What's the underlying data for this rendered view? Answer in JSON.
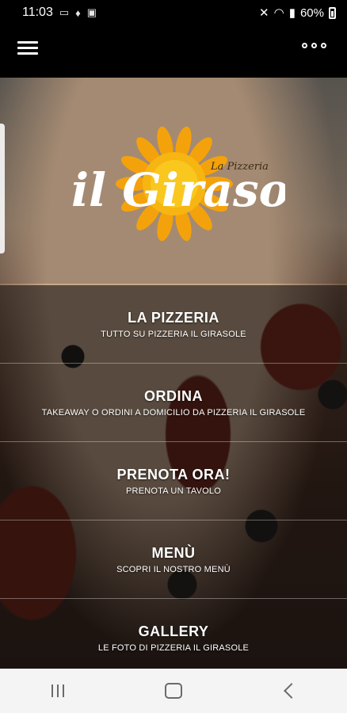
{
  "status_bar": {
    "time": "11:03",
    "battery": "60%",
    "icons": [
      "laptop-icon",
      "notification-icon",
      "message-icon",
      "mute-icon",
      "wifi-icon",
      "signal-icon",
      "battery-icon"
    ]
  },
  "app_bar": {
    "menu_icon": "hamburger-menu-icon",
    "more_icon": "more-options-icon"
  },
  "logo": {
    "name": "il Girasole",
    "script_text": "La Pizzeria",
    "colors": {
      "sun": "#f4a20c",
      "sun_center": "#f7c21a",
      "text": "#ffffff"
    }
  },
  "menu": [
    {
      "title": "LA PIZZERIA",
      "subtitle": "TUTTO SU PIZZERIA IL GIRASOLE"
    },
    {
      "title": "ORDINA",
      "subtitle": "TAKEAWAY O ORDINI A DOMICILIO DA PIZZERIA IL GIRASOLE"
    },
    {
      "title": "PRENOTA ORA!",
      "subtitle": "PRENOTA UN TAVOLO"
    },
    {
      "title": "MENÙ",
      "subtitle": "SCOPRI IL NOSTRO MENÙ"
    },
    {
      "title": "GALLERY",
      "subtitle": "LE FOTO DI PIZZERIA IL GIRASOLE"
    }
  ],
  "nav_bar": {
    "icons": [
      "recents-icon",
      "home-icon",
      "back-icon"
    ]
  }
}
